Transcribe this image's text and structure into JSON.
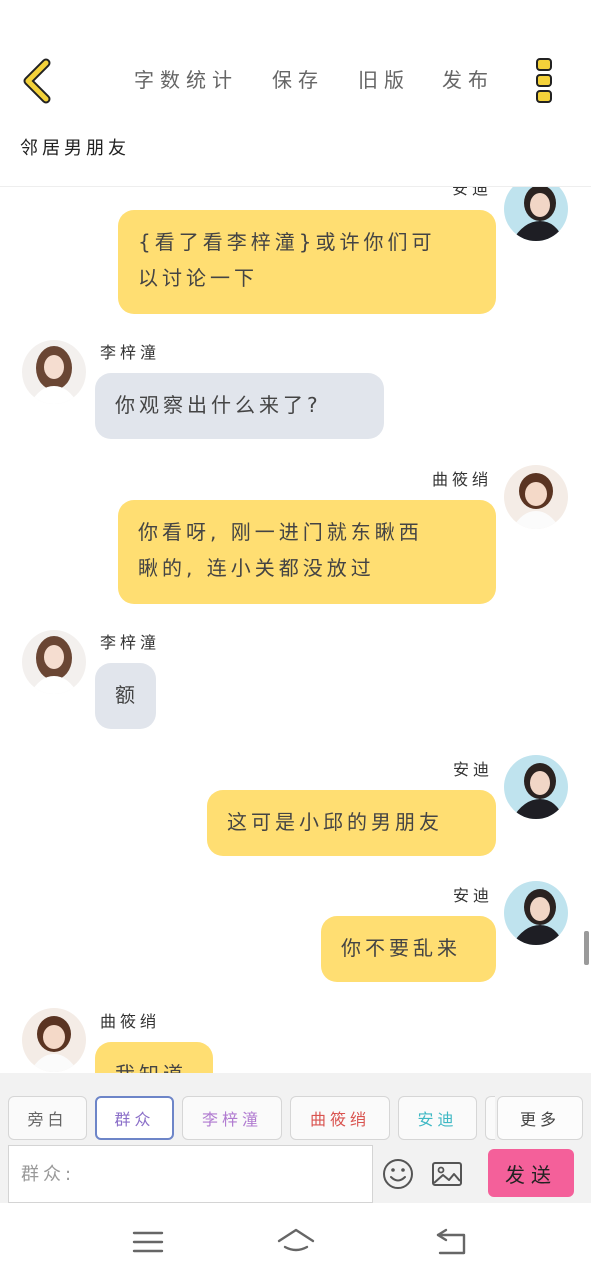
{
  "toolbar": {
    "word_count": "字数统计",
    "save": "保存",
    "old_version": "旧版",
    "publish": "发布"
  },
  "document": {
    "title": "邻居男朋友"
  },
  "messages": [
    {
      "sender": "安迪",
      "text_lines": [
        "{看了看李梓潼}或许你们可",
        "以讨论一下"
      ],
      "side": "right"
    },
    {
      "sender": "李梓潼",
      "text_lines": [
        "你观察出什么来了?"
      ],
      "side": "left"
    },
    {
      "sender": "曲筱绡",
      "text_lines": [
        "你看呀, 刚一进门就东瞅西",
        "瞅的, 连小关都没放过"
      ],
      "side": "right"
    },
    {
      "sender": "李梓潼",
      "text_lines": [
        "额"
      ],
      "side": "left"
    },
    {
      "sender": "安迪",
      "text_lines": [
        "这可是小邱的男朋友"
      ],
      "side": "right"
    },
    {
      "sender": "安迪",
      "text_lines": [
        "你不要乱来"
      ],
      "side": "right"
    },
    {
      "sender": "曲筱绡",
      "text_lines": [
        "我知道"
      ],
      "side": "left"
    }
  ],
  "roles": [
    {
      "label": "旁白",
      "color": "#666666"
    },
    {
      "label": "群众",
      "color": "#8a6ec8"
    },
    {
      "label": "李梓潼",
      "color": "#b07ad0"
    },
    {
      "label": "曲筱绡",
      "color": "#d9534f"
    },
    {
      "label": "安迪",
      "color": "#3fb8c4"
    }
  ],
  "more_label": "更多",
  "input": {
    "prefix": "群众:"
  },
  "send_label": "发送",
  "colors": {
    "accent_yellow": "#ffde72",
    "bubble_gray": "#e1e5ec",
    "send_pink": "#f4609a",
    "back_icon": "#f4d23a"
  }
}
